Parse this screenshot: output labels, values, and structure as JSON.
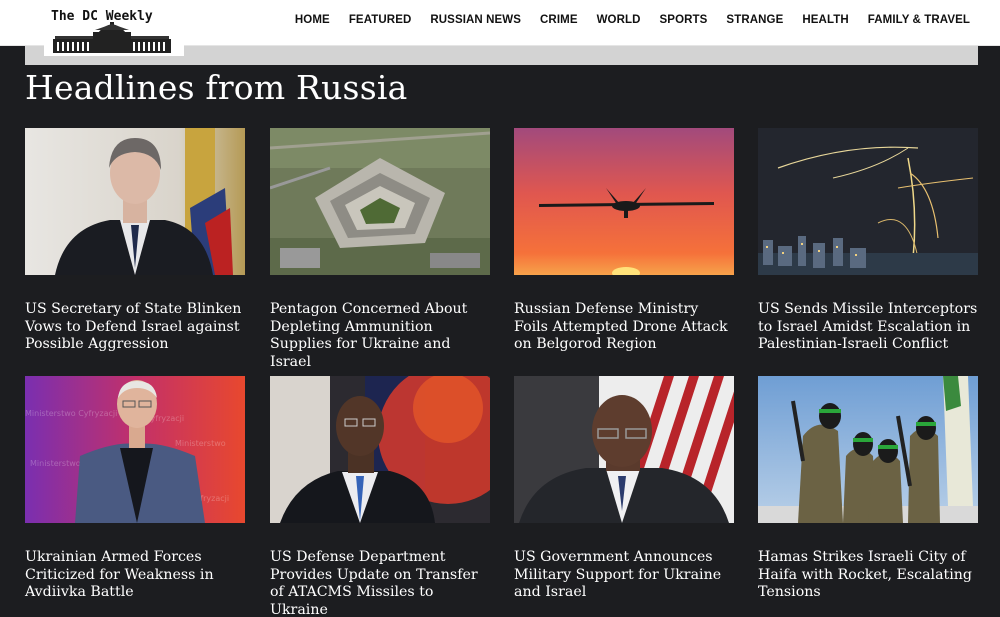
{
  "site": {
    "logo_text": "The DC Weekly"
  },
  "nav": {
    "items": [
      "HOME",
      "FEATURED",
      "RUSSIAN NEWS",
      "CRIME",
      "WORLD",
      "SPORTS",
      "STRANGE",
      "HEALTH",
      "FAMILY & TRAVEL"
    ]
  },
  "page": {
    "title": "Headlines from Russia"
  },
  "articles": [
    {
      "headline": "US Secretary of State Blinken Vows to Defend Israel against Possible Aggression",
      "image": "man-in-suit-with-flag"
    },
    {
      "headline": "Pentagon Concerned About Depleting Ammunition Supplies for Ukraine and Israel",
      "image": "pentagon-aerial"
    },
    {
      "headline": "Russian Defense Ministry Foils Attempted Drone Attack on Belgorod Region",
      "image": "drone-sunset"
    },
    {
      "headline": "US Sends Missile Interceptors to Israel Amidst Escalation in Palestinian-Israeli Conflict",
      "image": "missiles-night-sky"
    },
    {
      "headline": "Ukrainian Armed Forces Criticized for Weakness in Avdiivka Battle",
      "image": "man-at-conference"
    },
    {
      "headline": "US Defense Department Provides Update on Transfer of ATACMS Missiles to Ukraine",
      "image": "official-speaking"
    },
    {
      "headline": "US Government Announces Military Support for Ukraine and Israel",
      "image": "official-with-flag"
    },
    {
      "headline": "Hamas Strikes Israeli City of Haifa with Rocket, Escalating Tensions",
      "image": "armed-fighters"
    }
  ]
}
